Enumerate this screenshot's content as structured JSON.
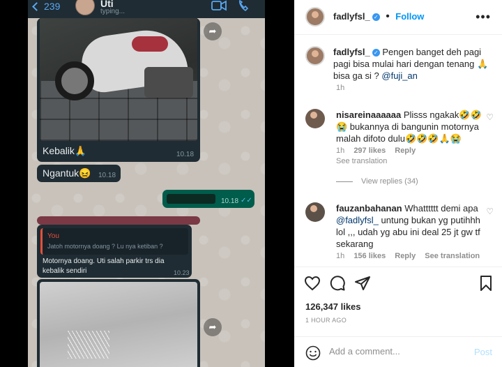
{
  "chat": {
    "back_count": "239",
    "contact_name": "Uti",
    "contact_status": "typing...",
    "caption1": "Kebalik🙏",
    "time1": "10.18",
    "msg_ngantuk": "Ngantuk😖",
    "time2": "10.18",
    "time3": "10.18",
    "quote_name": "You",
    "quote_text": "Jatoh motornya doang ? Lu nya ketiban ?",
    "reply_text": "Motornya doang. Uti salah parkir trs dia kebalik sendiri",
    "time4": "10.23"
  },
  "post": {
    "username": "fadlyfsl_",
    "follow_label": "Follow",
    "caption_text": "Pengen banget deh pagi pagi bisa mulai hari dengan tenang 🙏 bisa ga si ?",
    "caption_mention": "@fuji_an",
    "caption_age": "1h",
    "comments": [
      {
        "username": "nisareinaaaaaa",
        "text": "Plisss ngakak🤣🤣😭 bukannya di bangunin motornya malah difoto dulu🤣🤣🤣🙏😭",
        "age": "1h",
        "likes": "297 likes",
        "reply": "Reply",
        "translation": "See translation"
      },
      {
        "username": "fauzanbahanan",
        "text": "Whatttttt demi apa",
        "mention": "@fadlyfsl_",
        "text2": "untung bukan yg putihhh lol ,,, udah yg abu ini deal 25 jt gw tf sekarang",
        "age": "1h",
        "likes": "156 likes",
        "reply": "Reply",
        "translation": "See translation"
      }
    ],
    "view_replies": "View replies (34)",
    "like_count": "126,347 likes",
    "time_ago": "1 HOUR AGO",
    "add_comment_placeholder": "Add a comment...",
    "post_button": "Post"
  },
  "colors": {
    "follow_blue": "#0095f6",
    "verified_blue": "#3897f0",
    "wa_outgoing": "#005c4b",
    "wa_incoming": "#1f2c33"
  }
}
